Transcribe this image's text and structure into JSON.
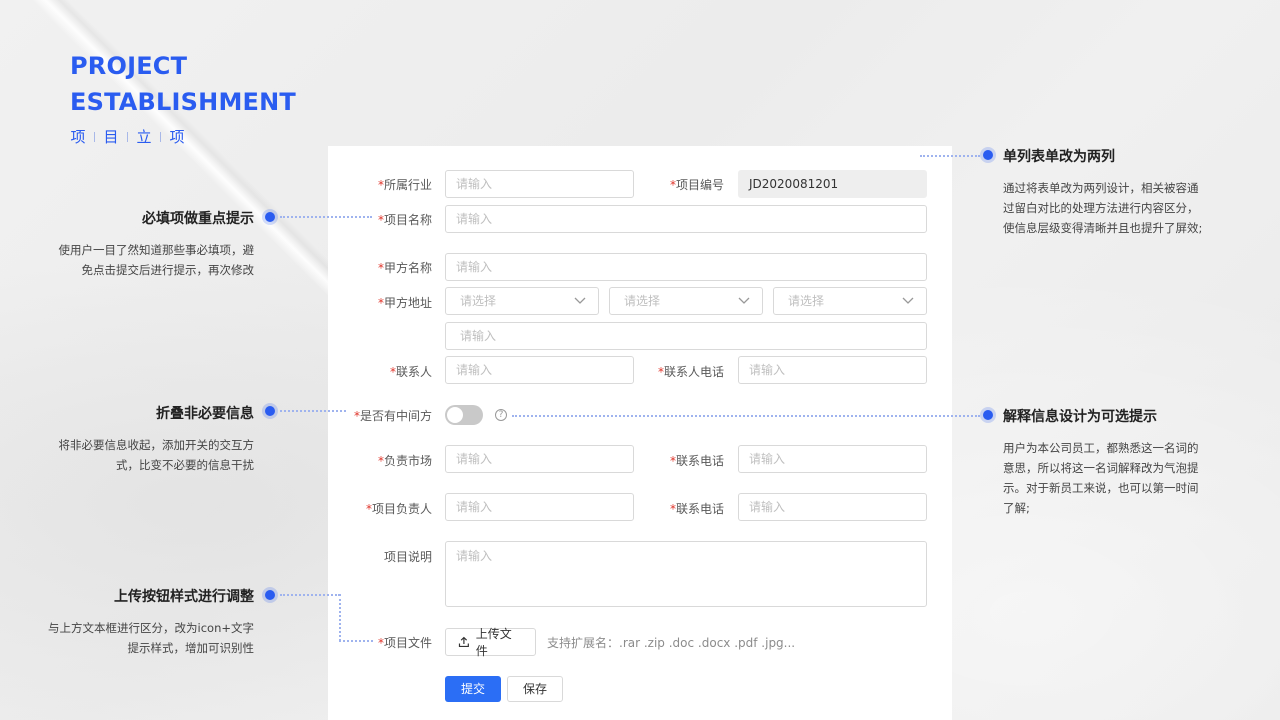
{
  "header": {
    "title_line1": "PROJECT",
    "title_line2": "ESTABLISHMENT",
    "subtitle_chars": [
      "项",
      "目",
      "立",
      "项"
    ]
  },
  "form": {
    "industry": {
      "label": "所属行业",
      "placeholder": "请输入"
    },
    "project_no": {
      "label": "项目编号",
      "value": "JD2020081201"
    },
    "project_name": {
      "label": "项目名称",
      "placeholder": "请输入"
    },
    "party_a_name": {
      "label": "甲方名称",
      "placeholder": "请输入"
    },
    "party_a_address": {
      "label": "甲方地址",
      "selects": [
        "请选择",
        "请选择",
        "请选择"
      ],
      "detail_placeholder": "请输入"
    },
    "contact": {
      "label": "联系人",
      "placeholder": "请输入"
    },
    "contact_phone": {
      "label": "联系人电话",
      "placeholder": "请输入"
    },
    "has_intermediary": {
      "label": "是否有中间方",
      "help_icon": "question-circle-icon",
      "toggle_on": false
    },
    "market": {
      "label": "负责市场",
      "placeholder": "请输入"
    },
    "market_phone": {
      "label": "联系电话",
      "placeholder": "请输入"
    },
    "project_lead": {
      "label": "项目负责人",
      "placeholder": "请输入"
    },
    "lead_phone": {
      "label": "联系电话",
      "placeholder": "请输入"
    },
    "description": {
      "label": "项目说明",
      "placeholder": "请输入"
    },
    "file": {
      "label": "项目文件",
      "upload_label": "上传文件",
      "hint": "支持扩展名：.rar .zip .doc .docx .pdf .jpg..."
    },
    "submit_label": "提交",
    "save_label": "保存",
    "required_mark": "*"
  },
  "annotations": {
    "required": {
      "title": "必填项做重点提示",
      "desc": "使用户一目了然知道那些事必填项，避免点击提交后进行提示，再次修改"
    },
    "collapse": {
      "title": "折叠非必要信息",
      "desc": "将非必要信息收起，添加开关的交互方式，比变不必要的信息干扰"
    },
    "upload": {
      "title": "上传按钮样式进行调整",
      "desc": "与上方文本框进行区分，改为icon+文字提示样式，增加可识别性"
    },
    "two_column": {
      "title": "单列表单改为两列",
      "desc": "通过将表单改为两列设计，相关被容通过留白对比的处理方法进行内容区分，使信息层级变得清晰并且也提升了屏效;"
    },
    "tooltip": {
      "title": "解释信息设计为可选提示",
      "desc": "用户为本公司员工，都熟悉这一名词的意思，所以将这一名词解释改为气泡提示。对于新员工来说，也可以第一时间了解;"
    }
  },
  "colors": {
    "accent": "#2a5cf0",
    "primary_button": "#2b6ef5",
    "required": "#e0352b"
  }
}
